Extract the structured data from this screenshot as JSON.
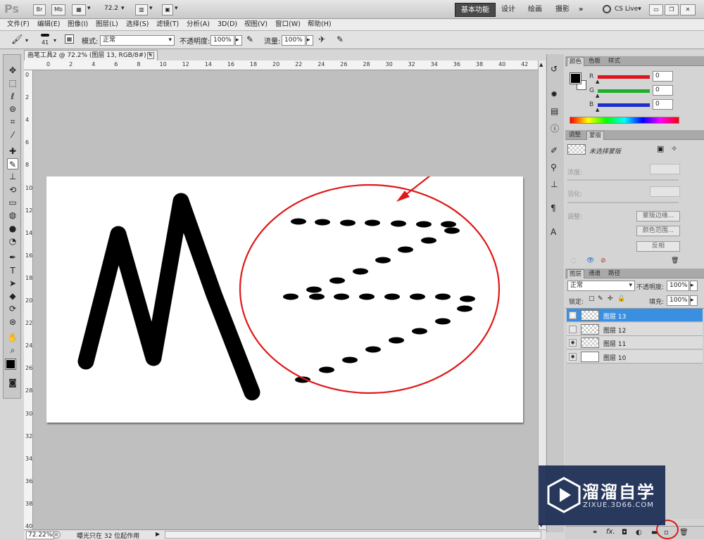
{
  "app": {
    "logo": "Ps",
    "bridge_btn": "Br",
    "mini_btn": "Mb",
    "zoom_value": "72.2",
    "workspaces": [
      "基本功能",
      "设计",
      "绘画",
      "摄影"
    ],
    "more": "»",
    "cs_live": "CS Live▾"
  },
  "menu": [
    "文件(F)",
    "编辑(E)",
    "图像(I)",
    "图层(L)",
    "选择(S)",
    "滤镜(T)",
    "分析(A)",
    "3D(D)",
    "视图(V)",
    "窗口(W)",
    "帮助(H)"
  ],
  "options": {
    "brush_size": "41",
    "mode_label": "模式:",
    "mode_value": "正常",
    "opacity_label": "不透明度:",
    "opacity_value": "100%",
    "flow_label": "流量:",
    "flow_value": "100%"
  },
  "document": {
    "tab_title": "画笔工具2 @ 72.2% (图层 13, RGB/8#) *",
    "close": "✕"
  },
  "rulers": {
    "h": [
      "0",
      "2",
      "4",
      "6",
      "8",
      "10",
      "12",
      "14",
      "16",
      "18",
      "20",
      "22",
      "24",
      "26",
      "28",
      "30",
      "32",
      "34",
      "36",
      "38",
      "40",
      "42"
    ],
    "v": [
      "0",
      "2",
      "4",
      "6",
      "8",
      "10",
      "12",
      "14",
      "16",
      "18",
      "20",
      "22",
      "24",
      "26",
      "28",
      "30",
      "32",
      "34",
      "36",
      "38",
      "40"
    ]
  },
  "status": {
    "zoom": "72.22%",
    "message": "曝光只在 32 位起作用"
  },
  "color_panel": {
    "tabs": [
      "颜色",
      "色板",
      "样式"
    ],
    "channels": [
      {
        "name": "R",
        "value": "0",
        "color": "#e0141e"
      },
      {
        "name": "G",
        "value": "0",
        "color": "#1cae2c"
      },
      {
        "name": "B",
        "value": "0",
        "color": "#1c2fd0"
      }
    ]
  },
  "mask_panel": {
    "tabs": [
      "调整",
      "蒙版"
    ],
    "title": "未选择蒙版",
    "density_label": "浓度:",
    "feather_label": "羽化:",
    "refine_label": "调整:",
    "buttons": [
      "蒙版边缘...",
      "颜色范围...",
      "反相"
    ]
  },
  "layers_panel": {
    "tabs": [
      "图层",
      "通道",
      "路径"
    ],
    "blend_mode": "正常",
    "opacity_label": "不透明度:",
    "opacity_value": "100%",
    "lock_label": "锁定:",
    "fill_label": "填充:",
    "fill_value": "100%",
    "layers": [
      {
        "name": "图层 13",
        "visible": true,
        "selected": true
      },
      {
        "name": "图层 12",
        "visible": false,
        "selected": false
      },
      {
        "name": "图层 11",
        "visible": true,
        "selected": false
      },
      {
        "name": "图层 10",
        "visible": true,
        "selected": false
      }
    ]
  },
  "watermark": {
    "title": "溜溜自学",
    "url": "ZIXUE.3D66.COM"
  },
  "annotation_color": "#e01818"
}
